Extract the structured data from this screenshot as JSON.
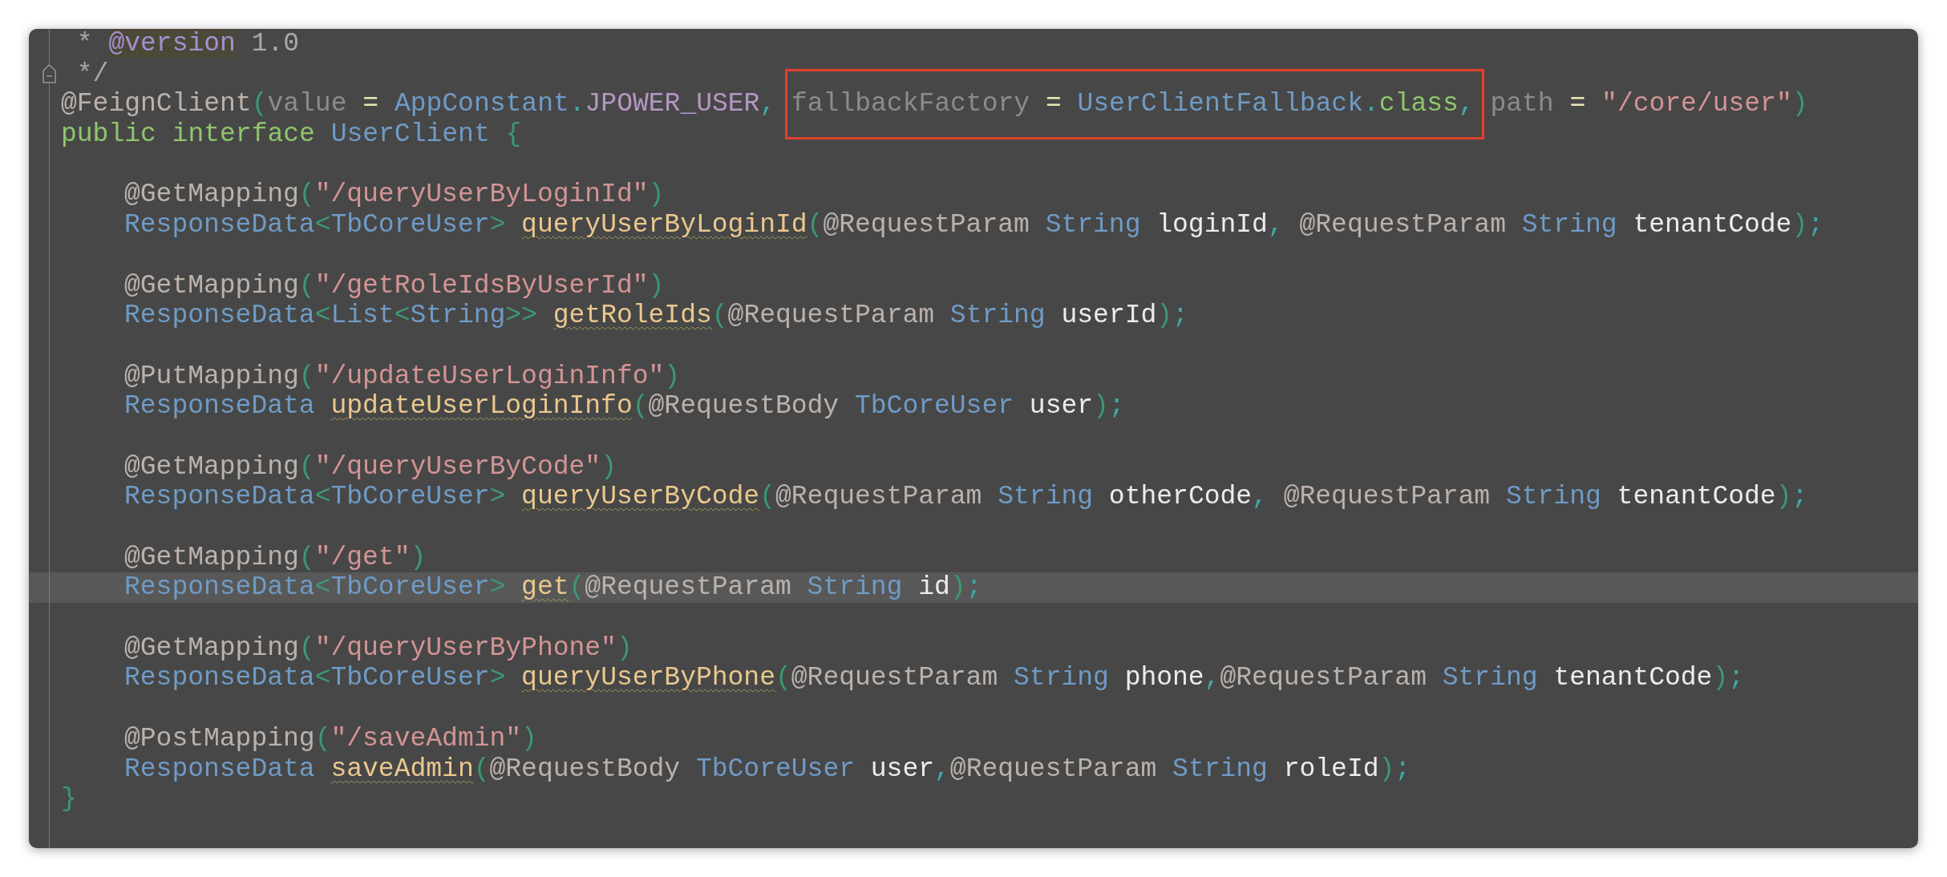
{
  "comment_lines": [
    {
      "fold": false,
      "tokens": [
        {
          "text": " * ",
          "kind": "comment"
        },
        {
          "text": "@version",
          "kind": "doctag"
        },
        {
          "text": " 1.0",
          "kind": "comment"
        }
      ]
    },
    {
      "fold": true,
      "tokens": [
        {
          "text": " */",
          "kind": "comment"
        }
      ]
    }
  ],
  "annotation_line": [
    {
      "text": "@FeignClient",
      "kind": "ann"
    },
    {
      "text": "(",
      "kind": "paren"
    },
    {
      "text": "value",
      "kind": "param"
    },
    {
      "text": " = ",
      "kind": "op"
    },
    {
      "text": "AppConstant",
      "kind": "type"
    },
    {
      "text": ".",
      "kind": "dot"
    },
    {
      "text": "JPOWER_USER",
      "kind": "const"
    },
    {
      "text": ", ",
      "kind": "punct"
    },
    {
      "text": "fallbackFactory",
      "kind": "param",
      "boxed": true
    },
    {
      "text": " = ",
      "kind": "op",
      "boxed": true
    },
    {
      "text": "UserClientFallback",
      "kind": "type",
      "boxed": true
    },
    {
      "text": ".",
      "kind": "dot",
      "boxed": true
    },
    {
      "text": "class",
      "kind": "kw",
      "boxed": true
    },
    {
      "text": ",",
      "kind": "punct",
      "boxed": true
    },
    {
      "text": " path",
      "kind": "param"
    },
    {
      "text": " = ",
      "kind": "op"
    },
    {
      "text": "\"/core/user\"",
      "kind": "str"
    },
    {
      "text": ")",
      "kind": "paren"
    }
  ],
  "interface_line": [
    {
      "text": "public interface ",
      "kind": "kw"
    },
    {
      "text": "UserClient ",
      "kind": "type"
    },
    {
      "text": "{",
      "kind": "brace"
    }
  ],
  "methods": [
    {
      "current": false,
      "annotation": [
        {
          "text": "@GetMapping",
          "kind": "ann"
        },
        {
          "text": "(",
          "kind": "paren"
        },
        {
          "text": "\"/queryUserByLoginId\"",
          "kind": "str"
        },
        {
          "text": ")",
          "kind": "paren"
        }
      ],
      "signature": [
        {
          "text": "ResponseData",
          "kind": "type"
        },
        {
          "text": "<",
          "kind": "paren"
        },
        {
          "text": "TbCoreUser",
          "kind": "type"
        },
        {
          "text": "> ",
          "kind": "paren"
        },
        {
          "text": "queryUserByLoginId",
          "kind": "method"
        },
        {
          "text": "(",
          "kind": "paren"
        },
        {
          "text": "@RequestParam ",
          "kind": "ann"
        },
        {
          "text": "String ",
          "kind": "type"
        },
        {
          "text": "loginId",
          "kind": "plain"
        },
        {
          "text": ", ",
          "kind": "punct"
        },
        {
          "text": "@RequestParam ",
          "kind": "ann"
        },
        {
          "text": "String ",
          "kind": "type"
        },
        {
          "text": "tenantCode",
          "kind": "plain"
        },
        {
          "text": ")",
          "kind": "paren"
        },
        {
          "text": ";",
          "kind": "punct"
        }
      ]
    },
    {
      "current": false,
      "annotation": [
        {
          "text": "@GetMapping",
          "kind": "ann"
        },
        {
          "text": "(",
          "kind": "paren"
        },
        {
          "text": "\"/getRoleIdsByUserId\"",
          "kind": "str"
        },
        {
          "text": ")",
          "kind": "paren"
        }
      ],
      "signature": [
        {
          "text": "ResponseData",
          "kind": "type"
        },
        {
          "text": "<",
          "kind": "paren"
        },
        {
          "text": "List",
          "kind": "type"
        },
        {
          "text": "<",
          "kind": "paren"
        },
        {
          "text": "String",
          "kind": "type"
        },
        {
          "text": ">> ",
          "kind": "paren"
        },
        {
          "text": "getRoleIds",
          "kind": "method"
        },
        {
          "text": "(",
          "kind": "paren"
        },
        {
          "text": "@RequestParam ",
          "kind": "ann"
        },
        {
          "text": "String ",
          "kind": "type"
        },
        {
          "text": "userId",
          "kind": "plain"
        },
        {
          "text": ")",
          "kind": "paren"
        },
        {
          "text": ";",
          "kind": "punct"
        }
      ]
    },
    {
      "current": false,
      "annotation": [
        {
          "text": "@PutMapping",
          "kind": "ann"
        },
        {
          "text": "(",
          "kind": "paren"
        },
        {
          "text": "\"/updateUserLoginInfo\"",
          "kind": "str"
        },
        {
          "text": ")",
          "kind": "paren"
        }
      ],
      "signature": [
        {
          "text": "ResponseData ",
          "kind": "type"
        },
        {
          "text": "updateUserLoginInfo",
          "kind": "method"
        },
        {
          "text": "(",
          "kind": "paren"
        },
        {
          "text": "@RequestBody ",
          "kind": "ann"
        },
        {
          "text": "TbCoreUser ",
          "kind": "type"
        },
        {
          "text": "user",
          "kind": "plain"
        },
        {
          "text": ")",
          "kind": "paren"
        },
        {
          "text": ";",
          "kind": "punct"
        }
      ]
    },
    {
      "current": false,
      "annotation": [
        {
          "text": "@GetMapping",
          "kind": "ann"
        },
        {
          "text": "(",
          "kind": "paren"
        },
        {
          "text": "\"/queryUserByCode\"",
          "kind": "str"
        },
        {
          "text": ")",
          "kind": "paren"
        }
      ],
      "signature": [
        {
          "text": "ResponseData",
          "kind": "type"
        },
        {
          "text": "<",
          "kind": "paren"
        },
        {
          "text": "TbCoreUser",
          "kind": "type"
        },
        {
          "text": "> ",
          "kind": "paren"
        },
        {
          "text": "queryUserByCode",
          "kind": "method"
        },
        {
          "text": "(",
          "kind": "paren"
        },
        {
          "text": "@RequestParam ",
          "kind": "ann"
        },
        {
          "text": "String ",
          "kind": "type"
        },
        {
          "text": "otherCode",
          "kind": "plain"
        },
        {
          "text": ", ",
          "kind": "punct"
        },
        {
          "text": "@RequestParam ",
          "kind": "ann"
        },
        {
          "text": "String ",
          "kind": "type"
        },
        {
          "text": "tenantCode",
          "kind": "plain"
        },
        {
          "text": ")",
          "kind": "paren"
        },
        {
          "text": ";",
          "kind": "punct"
        }
      ]
    },
    {
      "current": true,
      "annotation": [
        {
          "text": "@GetMapping",
          "kind": "ann"
        },
        {
          "text": "(",
          "kind": "paren"
        },
        {
          "text": "\"/get\"",
          "kind": "str"
        },
        {
          "text": ")",
          "kind": "paren"
        }
      ],
      "signature": [
        {
          "text": "ResponseData",
          "kind": "type"
        },
        {
          "text": "<",
          "kind": "paren"
        },
        {
          "text": "TbCoreUser",
          "kind": "type"
        },
        {
          "text": "> ",
          "kind": "paren"
        },
        {
          "text": "get",
          "kind": "method"
        },
        {
          "text": "(",
          "kind": "paren"
        },
        {
          "text": "@RequestParam ",
          "kind": "ann"
        },
        {
          "text": "String ",
          "kind": "type"
        },
        {
          "text": "id",
          "kind": "plain"
        },
        {
          "text": ")",
          "kind": "paren"
        },
        {
          "text": ";",
          "kind": "punct"
        }
      ]
    },
    {
      "current": false,
      "annotation": [
        {
          "text": "@GetMapping",
          "kind": "ann"
        },
        {
          "text": "(",
          "kind": "paren"
        },
        {
          "text": "\"/queryUserByPhone\"",
          "kind": "str"
        },
        {
          "text": ")",
          "kind": "paren"
        }
      ],
      "signature": [
        {
          "text": "ResponseData",
          "kind": "type"
        },
        {
          "text": "<",
          "kind": "paren"
        },
        {
          "text": "TbCoreUser",
          "kind": "type"
        },
        {
          "text": "> ",
          "kind": "paren"
        },
        {
          "text": "queryUserByPhone",
          "kind": "method"
        },
        {
          "text": "(",
          "kind": "paren"
        },
        {
          "text": "@RequestParam ",
          "kind": "ann"
        },
        {
          "text": "String ",
          "kind": "type"
        },
        {
          "text": "phone",
          "kind": "plain"
        },
        {
          "text": ",",
          "kind": "punct"
        },
        {
          "text": "@RequestParam ",
          "kind": "ann"
        },
        {
          "text": "String ",
          "kind": "type"
        },
        {
          "text": "tenantCode",
          "kind": "plain"
        },
        {
          "text": ")",
          "kind": "paren"
        },
        {
          "text": ";",
          "kind": "punct"
        }
      ]
    },
    {
      "current": false,
      "annotation": [
        {
          "text": "@PostMapping",
          "kind": "ann"
        },
        {
          "text": "(",
          "kind": "paren"
        },
        {
          "text": "\"/saveAdmin\"",
          "kind": "str"
        },
        {
          "text": ")",
          "kind": "paren"
        }
      ],
      "signature": [
        {
          "text": "ResponseData ",
          "kind": "type"
        },
        {
          "text": "saveAdmin",
          "kind": "method"
        },
        {
          "text": "(",
          "kind": "paren"
        },
        {
          "text": "@RequestBody ",
          "kind": "ann"
        },
        {
          "text": "TbCoreUser ",
          "kind": "type"
        },
        {
          "text": "user",
          "kind": "plain"
        },
        {
          "text": ",",
          "kind": "punct"
        },
        {
          "text": "@RequestParam ",
          "kind": "ann"
        },
        {
          "text": "String ",
          "kind": "type"
        },
        {
          "text": "roleId",
          "kind": "plain"
        },
        {
          "text": ")",
          "kind": "paren"
        },
        {
          "text": ";",
          "kind": "punct"
        }
      ]
    }
  ],
  "closing_line": [
    {
      "text": "}",
      "kind": "brace"
    }
  ]
}
